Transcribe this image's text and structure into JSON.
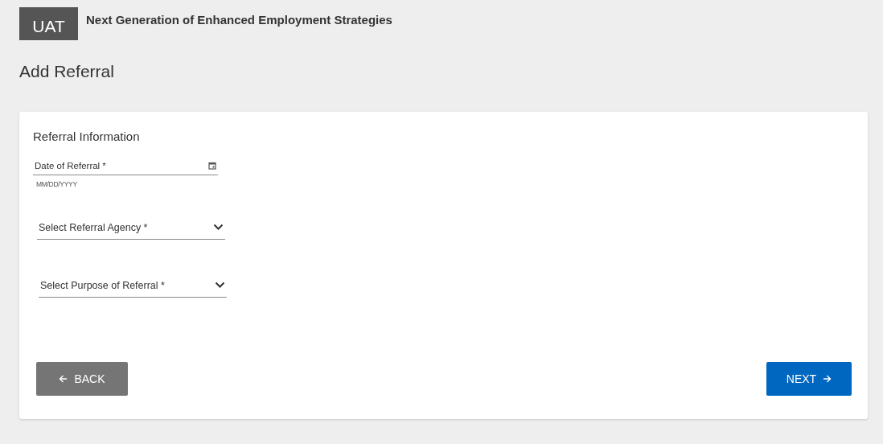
{
  "header": {
    "badge": "UAT",
    "title": "Next Generation of Enhanced Employment Strategies"
  },
  "page_title": "Add Referral",
  "card": {
    "title": "Referral Information",
    "fields": [
      {
        "kind": "date",
        "label": "Date of Referral *",
        "hint": "MM/DD/YYYY"
      },
      {
        "kind": "select",
        "label": "Select Referral Agency *"
      },
      {
        "kind": "select",
        "label": "Select Purpose of Referral *"
      }
    ],
    "buttons": [
      {
        "kind": "back",
        "label": "BACK"
      },
      {
        "kind": "next",
        "label": "NEXT"
      }
    ]
  }
}
